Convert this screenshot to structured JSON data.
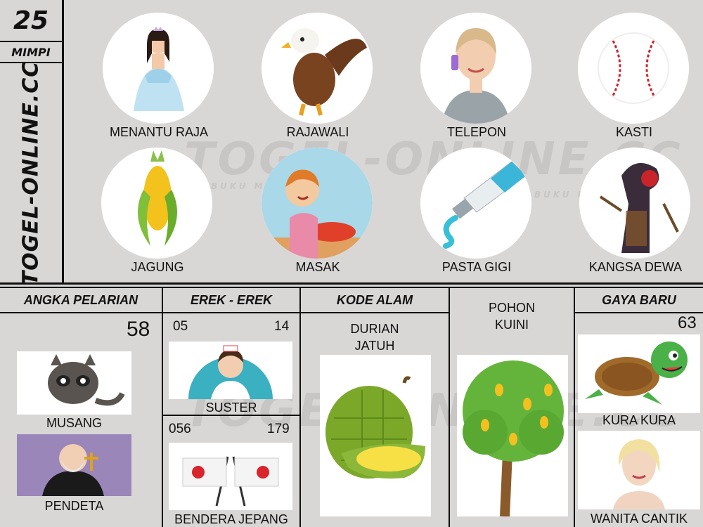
{
  "sidebar": {
    "number": "25",
    "mimpi": "MIMPI",
    "site": "TOGEL-ONLINE.CC"
  },
  "watermark": {
    "text": "TOGEL-ONLINE.CC",
    "small": "BUKU MIMPI"
  },
  "top_items": [
    {
      "label": "MENANTU RAJA",
      "icon": "princess-icon"
    },
    {
      "label": "RAJAWALI",
      "icon": "eagle-icon"
    },
    {
      "label": "TELEPON",
      "icon": "phone-woman-icon"
    },
    {
      "label": "KASTI",
      "icon": "baseball-icon"
    },
    {
      "label": "JAGUNG",
      "icon": "corn-icon"
    },
    {
      "label": "MASAK",
      "icon": "cooking-boy-icon"
    },
    {
      "label": "PASTA GIGI",
      "icon": "toothpaste-icon"
    },
    {
      "label": "KANGSA DEWA",
      "icon": "wayang-icon"
    }
  ],
  "sections": {
    "angka_pelarian": {
      "title": "ANGKA PELARIAN",
      "number": "58",
      "items": [
        {
          "label": "MUSANG",
          "icon": "civet-icon"
        },
        {
          "label": "PENDETA",
          "icon": "priest-icon"
        }
      ]
    },
    "erek_erek": {
      "title": "EREK - EREK",
      "rows": [
        {
          "left": "05",
          "right": "14",
          "label": "SUSTER",
          "icon": "nurse-icon"
        },
        {
          "left": "056",
          "right": "179",
          "label": "BENDERA JEPANG",
          "icon": "japan-flag-icon"
        }
      ]
    },
    "kode_alam": {
      "title": "KODE ALAM",
      "items": [
        {
          "label_line1": "DURIAN",
          "label_line2": "JATUH",
          "icon": "durian-icon"
        },
        {
          "label_line1": "POHON",
          "label_line2": "KUINI",
          "icon": "mango-tree-icon"
        }
      ]
    },
    "gaya_baru": {
      "title": "GAYA BARU",
      "number": "63",
      "items": [
        {
          "label": "KURA KURA",
          "icon": "turtle-icon"
        },
        {
          "label": "WANITA CANTIK",
          "icon": "woman-icon"
        }
      ]
    }
  }
}
